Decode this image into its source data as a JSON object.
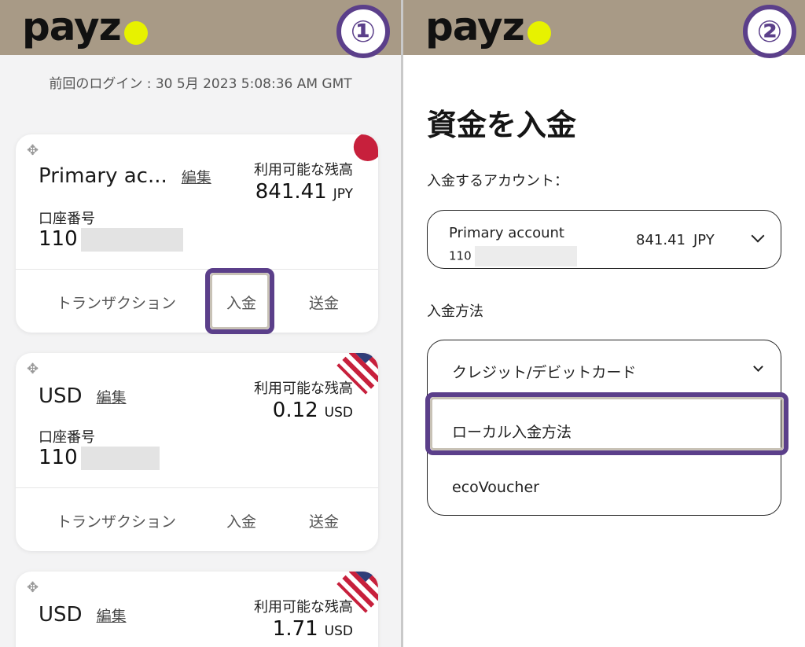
{
  "brand": {
    "name": "payz",
    "dot_color": "#e7f200",
    "bar_color": "#a89a86",
    "highlight_color": "#5b3f8a"
  },
  "step1": {
    "badge": "①",
    "last_login": "前回のログイン : 30 5月 2023 5:08:36 AM GMT"
  },
  "accounts": [
    {
      "name": "Primary ac...",
      "edit": "編集",
      "balance_label": "利用可能な残高",
      "balance": "841.41",
      "currency": "JPY",
      "number_label": "口座番号",
      "number_prefix": "110",
      "actions": [
        "トランザクション",
        "入金",
        "送金"
      ],
      "flag": "jp-flag"
    },
    {
      "name": "USD",
      "edit": "編集",
      "balance_label": "利用可能な残高",
      "balance": "0.12",
      "currency": "USD",
      "number_label": "口座番号",
      "number_prefix": "110",
      "actions": [
        "トランザクション",
        "入金",
        "送金"
      ],
      "flag": "us-flag"
    },
    {
      "name": "USD",
      "edit": "編集",
      "balance_label": "利用可能な残高",
      "balance": "1.71",
      "currency": "USD",
      "flag": "us-flag"
    }
  ],
  "step2": {
    "badge": "②",
    "title": "資金を入金",
    "account_label": "入金するアカウント：",
    "selected_account": {
      "name": "Primary account",
      "number_prefix": "110",
      "balance": "841.41",
      "currency": "JPY"
    },
    "method_label": "入金方法",
    "methods": [
      "クレジット/デビットカード",
      "ローカル入金方法",
      "ecoVoucher"
    ]
  }
}
